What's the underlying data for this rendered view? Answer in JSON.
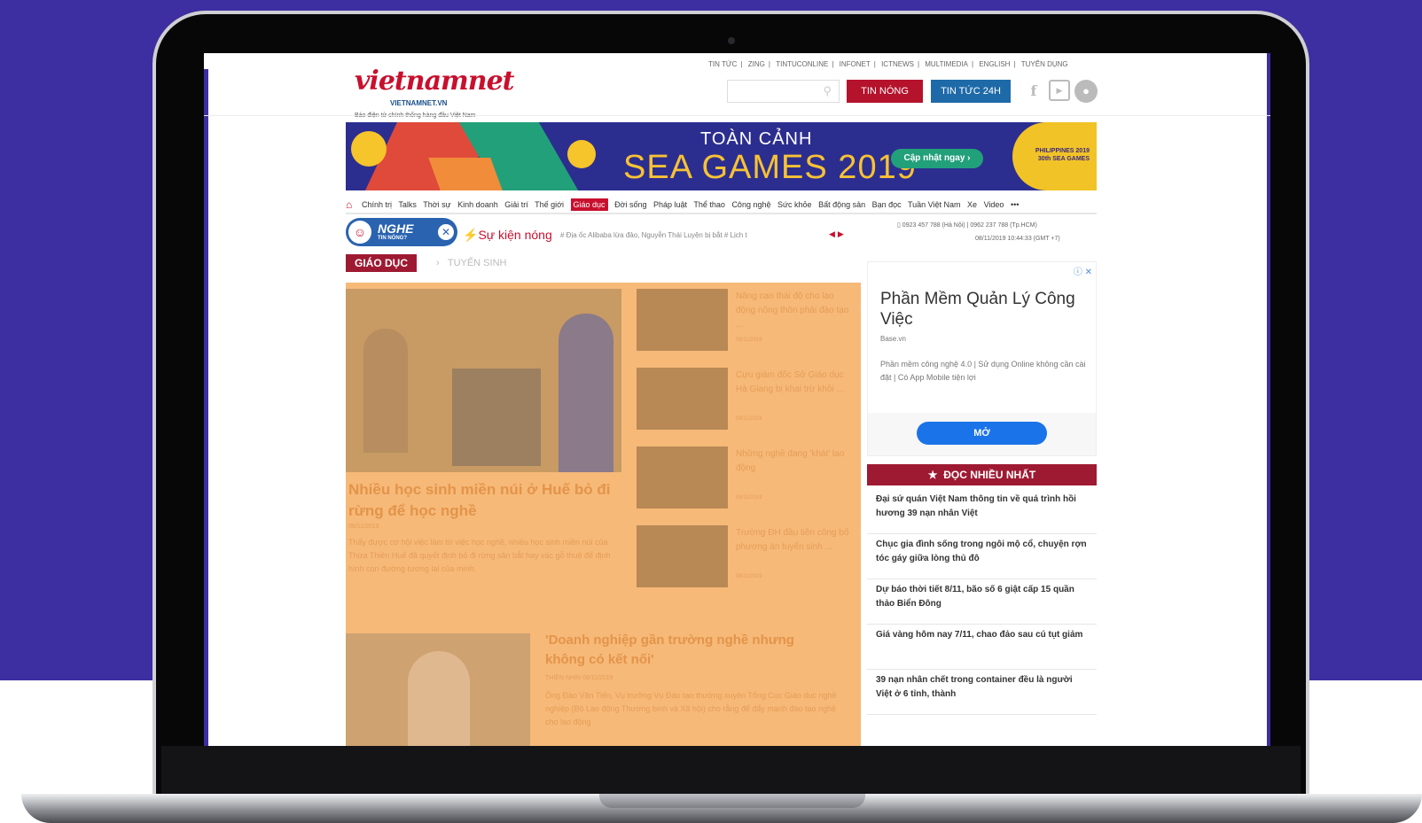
{
  "site": {
    "logo_text": "vietnamnet",
    "logo_sub": "VIETNAMNET.VN",
    "tagline": "Báo điện tử chính thống hàng đầu Việt Nam",
    "top_menu": [
      "TIN TỨC",
      "ZING",
      "TINTUCONLINE",
      "INFONET",
      "ICTNEWS",
      "MULTIMEDIA",
      "ENGLISH",
      "TUYỂN DỤNG"
    ],
    "btn_hot": "TIN NÓNG",
    "btn_24h": "TIN TỨC 24H"
  },
  "banner": {
    "title1": "TOÀN CẢNH",
    "title2": "SEA GAMES 2019",
    "cta": "Cập nhật ngay ›",
    "badge": "PHILIPPINES 2019 30th SEA GAMES"
  },
  "categories": [
    "Chính trị",
    "Talks",
    "Thời sự",
    "Kinh doanh",
    "Giải trí",
    "Thế giới",
    "Giáo dục",
    "Đời sống",
    "Pháp luật",
    "Thể thao",
    "Công nghệ",
    "Sức khỏe",
    "Bất động sản",
    "Bạn đọc",
    "Tuần Việt Nam",
    "Xe",
    "Video",
    "•••"
  ],
  "hot": {
    "nghe": "NGHE",
    "nghe_sub": "TIN NÓNG?",
    "label": "Sự kiện nóng",
    "ticker": "# Địa ốc Alibaba lừa đảo, Nguyễn Thái Luyện bị bắt  # Lịch t",
    "hotline": "0923 457 788 (Hà Nội) | 0962 237 788 (Tp.HCM)",
    "datetime": "08/11/2019 10:44:33 (GMT +7)"
  },
  "section": {
    "label": "GIÁO DỤC",
    "sub": "TUYỂN SINH"
  },
  "featured": {
    "title": "Nhiều học sinh miền núi ở Huế bỏ đi rừng để học nghề",
    "date": "08/11/2019",
    "sapo": "Thấy được cơ hội việc làm từ việc học nghề, nhiều học sinh miền núi của Thừa Thiên Huế đã quyết định bỏ đi rừng săn bắt hay vác gỗ thuê để định hình con đường tương lai của mình."
  },
  "side_news": [
    {
      "title": "Nâng cao thái độ cho lao động nông thôn phải đào tạo ...",
      "date": "08/11/2019"
    },
    {
      "title": "Cựu giám đốc Sở Giáo dục Hà Giang bị khai trừ khỏi ...",
      "date": "08/11/2019"
    },
    {
      "title": "Những nghề đang 'khát' lao động",
      "date": "08/11/2019"
    },
    {
      "title": "Trường ĐH đầu tiên công bố phương án tuyển sinh ...",
      "date": "08/11/2019"
    }
  ],
  "featured2": {
    "title": "'Doanh nghiệp gần trường nghề nhưng không có kết nối'",
    "meta": "THIỀN NHIN  08/11/2019",
    "sapo": "Ông Đào Văn Tiến, Vụ trưởng Vụ Đào tạo thường xuyên Tổng Cục Giáo dục nghề nghiệp (Bộ Lao động Thương binh và Xã hội) cho rằng để đẩy mạnh đào tạo nghề cho lao động"
  },
  "ad": {
    "title": "Phần Mềm Quản Lý Công Việc",
    "brand": "Base.vn",
    "desc": "Phần mềm công nghệ 4.0 | Sử dụng Online không cần cài đặt | Có App Mobile tiện lợi",
    "button": "MỞ"
  },
  "most_read": {
    "title": "ĐỌC NHIỀU NHẤT",
    "items": [
      "Đại sứ quán Việt Nam thông tin về quá trình hồi hương 39 nạn nhân Việt",
      "Chục gia đình sống trong ngôi mộ cổ, chuyện rợn tóc gáy giữa lòng thủ đô",
      "Dự báo thời tiết 8/11, bão số 6 giật cấp 15 quần thảo Biển Đông",
      "Giá vàng hôm nay 7/11, chao đảo sau cú tụt giảm",
      "39 nạn nhân chết trong container đều là người Việt ở 6 tỉnh, thành"
    ]
  },
  "colors": {
    "background_purple": "#3d2ea1",
    "brand_red": "#c8102e",
    "section_red": "#9e1a32",
    "hot_blue": "#1e6aa8",
    "highlight_orange": "#f6b978"
  }
}
